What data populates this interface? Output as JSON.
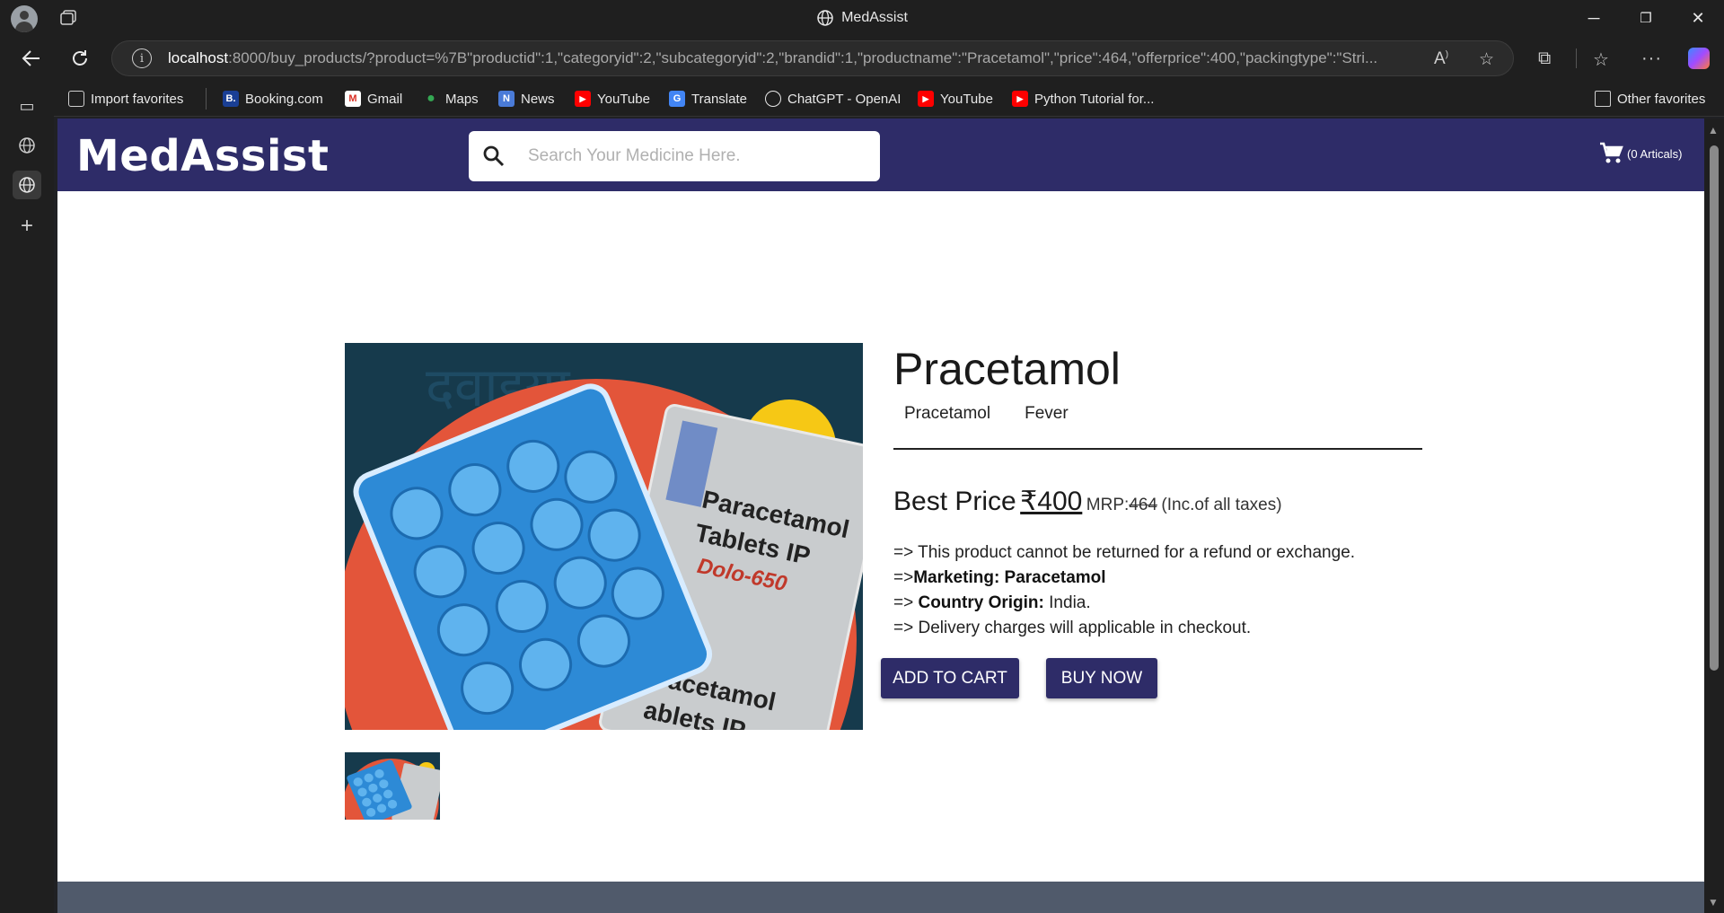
{
  "window": {
    "title": "MedAssist"
  },
  "address_bar": {
    "host": "localhost",
    "rest": ":8000/buy_products/?product=%7B\"productid\":1,\"categoryid\":2,\"subcategoryid\":2,\"brandid\":1,\"productname\":\"Pracetamol\",\"price\":464,\"offerprice\":400,\"packingtype\":\"Stri..."
  },
  "favorites": {
    "items": [
      {
        "label": "Import favorites",
        "icon": "import-icon"
      },
      {
        "label": "Booking.com",
        "icon": "booking-icon"
      },
      {
        "label": "Gmail",
        "icon": "gmail-icon"
      },
      {
        "label": "Maps",
        "icon": "maps-icon"
      },
      {
        "label": "News",
        "icon": "news-icon"
      },
      {
        "label": "YouTube",
        "icon": "youtube-icon"
      },
      {
        "label": "Translate",
        "icon": "translate-icon"
      },
      {
        "label": "ChatGPT - OpenAI",
        "icon": "chatgpt-icon"
      },
      {
        "label": "YouTube",
        "icon": "youtube-icon"
      },
      {
        "label": "Python Tutorial for...",
        "icon": "youtube-icon"
      }
    ],
    "other": "Other favorites"
  },
  "site": {
    "logo": "MedAssist",
    "search_placeholder": "Search Your Medicine Here.",
    "cart_label": "(0 Articals)"
  },
  "product": {
    "name": "Pracetamol",
    "tags": [
      "Pracetamol",
      "Fever"
    ],
    "best_price_label": "Best Price",
    "offer_price": "₹400",
    "mrp_label": "MRP:",
    "mrp_value": "464",
    "tax_note": "(Inc.of all taxes)",
    "details": {
      "line1": "=> This product cannot be returned for a refund or exchange.",
      "marketing_prefix": "=>",
      "marketing": "Marketing: Paracetamol",
      "origin_prefix": "=>",
      "origin_label": "Country Origin:",
      "origin_value": "India.",
      "line4": "=> Delivery charges will applicable in checkout."
    },
    "image_text": {
      "pack_line1": "Paracetamol",
      "pack_line2": "Tablets IP",
      "pack_brand": "Dolo-650",
      "pack_bottom1": "acetamol",
      "pack_bottom2": "ablets IP"
    }
  },
  "buttons": {
    "add_to_cart": "ADD TO CART",
    "buy_now": "BUY NOW"
  },
  "colors": {
    "brand": "#2e2c68",
    "footer": "#505a6b"
  }
}
